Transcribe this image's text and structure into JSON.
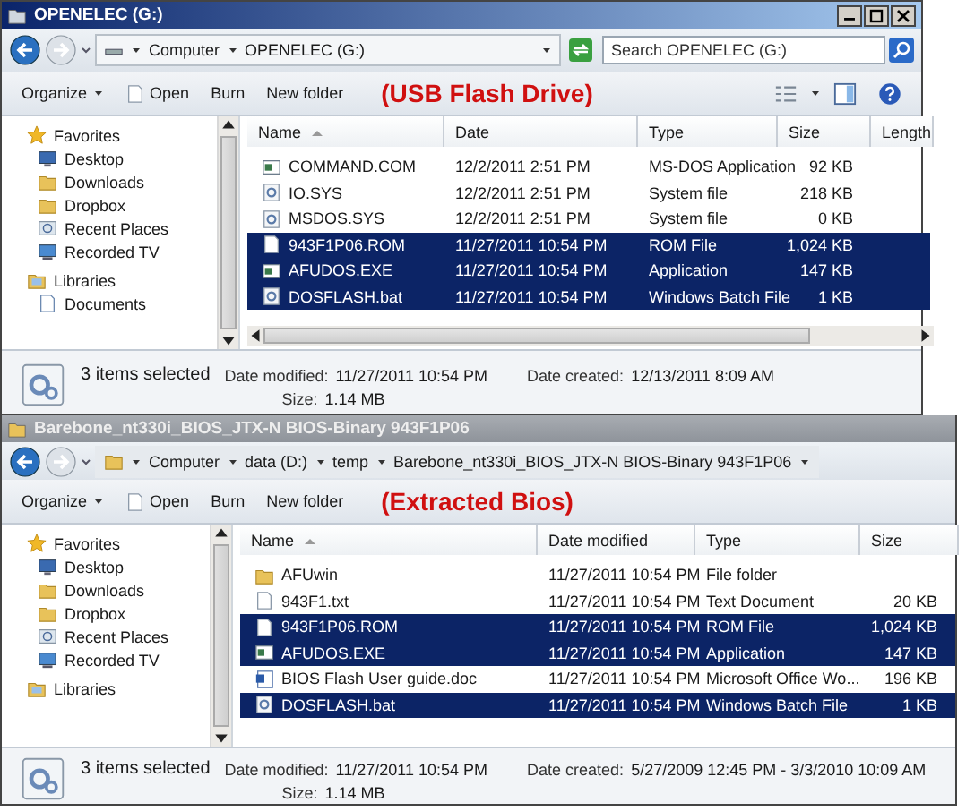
{
  "windows": [
    {
      "title": "OPENELEC (G:)",
      "active": true,
      "breadcrumb": [
        "Computer",
        "OPENELEC (G:)"
      ],
      "search": {
        "placeholder": "Search OPENELEC (G:)"
      },
      "toolbar": [
        "Organize",
        "Open",
        "Burn",
        "New folder"
      ],
      "annotation": "(USB Flash Drive)",
      "sidebar": [
        {
          "label": "Favorites",
          "kind": "star",
          "header": true
        },
        {
          "label": "Desktop",
          "kind": "desktop",
          "header": false
        },
        {
          "label": "Downloads",
          "kind": "folder",
          "header": false
        },
        {
          "label": "Dropbox",
          "kind": "folder",
          "header": false
        },
        {
          "label": "Recent Places",
          "kind": "recent",
          "header": false
        },
        {
          "label": "Recorded TV",
          "kind": "tv",
          "header": false
        },
        {
          "label": "Libraries",
          "kind": "library",
          "header": true
        },
        {
          "label": "Documents",
          "kind": "doc",
          "header": false
        }
      ],
      "columns": [
        "Name",
        "Date",
        "Type",
        "Size",
        "Length"
      ],
      "rows": [
        {
          "name": "COMMAND.COM",
          "date": "12/2/2011 2:51 PM",
          "type": "MS-DOS Application",
          "size": "92 KB",
          "kind": "app",
          "selected": false
        },
        {
          "name": "IO.SYS",
          "date": "12/2/2011 2:51 PM",
          "type": "System file",
          "size": "218 KB",
          "kind": "gear",
          "selected": false
        },
        {
          "name": "MSDOS.SYS",
          "date": "12/2/2011 2:51 PM",
          "type": "System file",
          "size": "0 KB",
          "kind": "gear",
          "selected": false
        },
        {
          "name": "943F1P06.ROM",
          "date": "11/27/2011 10:54 PM",
          "type": "ROM File",
          "size": "1,024 KB",
          "kind": "file",
          "selected": true
        },
        {
          "name": "AFUDOS.EXE",
          "date": "11/27/2011 10:54 PM",
          "type": "Application",
          "size": "147 KB",
          "kind": "app",
          "selected": true
        },
        {
          "name": "DOSFLASH.bat",
          "date": "11/27/2011 10:54 PM",
          "type": "Windows Batch File",
          "size": "1 KB",
          "kind": "gear",
          "selected": true
        }
      ],
      "status": {
        "count": "3 items selected",
        "details": [
          {
            "label": "Date modified:",
            "value": "11/27/2011 10:54 PM"
          },
          {
            "label": "Date created:",
            "value": "12/13/2011 8:09 AM"
          },
          {
            "label": "Size:",
            "value": "1.14 MB"
          }
        ]
      }
    },
    {
      "title": "Barebone_nt330i_BIOS_JTX-N BIOS-Binary 943F1P06",
      "active": false,
      "breadcrumb": [
        "Computer",
        "data (D:)",
        "temp",
        "Barebone_nt330i_BIOS_JTX-N BIOS-Binary 943F1P06"
      ],
      "toolbar": [
        "Organize",
        "Open",
        "Burn",
        "New folder"
      ],
      "annotation": "(Extracted Bios)",
      "sidebar": [
        {
          "label": "Favorites",
          "kind": "star",
          "header": true
        },
        {
          "label": "Desktop",
          "kind": "desktop",
          "header": false
        },
        {
          "label": "Downloads",
          "kind": "folder",
          "header": false
        },
        {
          "label": "Dropbox",
          "kind": "folder",
          "header": false
        },
        {
          "label": "Recent Places",
          "kind": "recent",
          "header": false
        },
        {
          "label": "Recorded TV",
          "kind": "tv",
          "header": false
        },
        {
          "label": "Libraries",
          "kind": "library",
          "header": true
        }
      ],
      "columns": [
        "Name",
        "Date modified",
        "Type",
        "Size"
      ],
      "rows": [
        {
          "name": "AFUwin",
          "date": "11/27/2011 10:54 PM",
          "type": "File folder",
          "size": "",
          "kind": "folder",
          "selected": false
        },
        {
          "name": "943F1.txt",
          "date": "11/27/2011 10:54 PM",
          "type": "Text Document",
          "size": "20 KB",
          "kind": "file",
          "selected": false
        },
        {
          "name": "943F1P06.ROM",
          "date": "11/27/2011 10:54 PM",
          "type": "ROM File",
          "size": "1,024 KB",
          "kind": "file",
          "selected": true
        },
        {
          "name": "AFUDOS.EXE",
          "date": "11/27/2011 10:54 PM",
          "type": "Application",
          "size": "147 KB",
          "kind": "app",
          "selected": true
        },
        {
          "name": "BIOS Flash User guide.doc",
          "date": "11/27/2011 10:54 PM",
          "type": "Microsoft Office Wo...",
          "size": "196 KB",
          "kind": "word",
          "selected": false
        },
        {
          "name": "DOSFLASH.bat",
          "date": "11/27/2011 10:54 PM",
          "type": "Windows Batch File",
          "size": "1 KB",
          "kind": "gear",
          "selected": true
        }
      ],
      "status": {
        "count": "3 items selected",
        "details": [
          {
            "label": "Date modified:",
            "value": "11/27/2011 10:54 PM"
          },
          {
            "label": "Date created:",
            "value": "5/27/2009 12:45 PM - 3/3/2010 10:09 AM"
          },
          {
            "label": "Size:",
            "value": "1.14 MB"
          }
        ]
      }
    }
  ]
}
